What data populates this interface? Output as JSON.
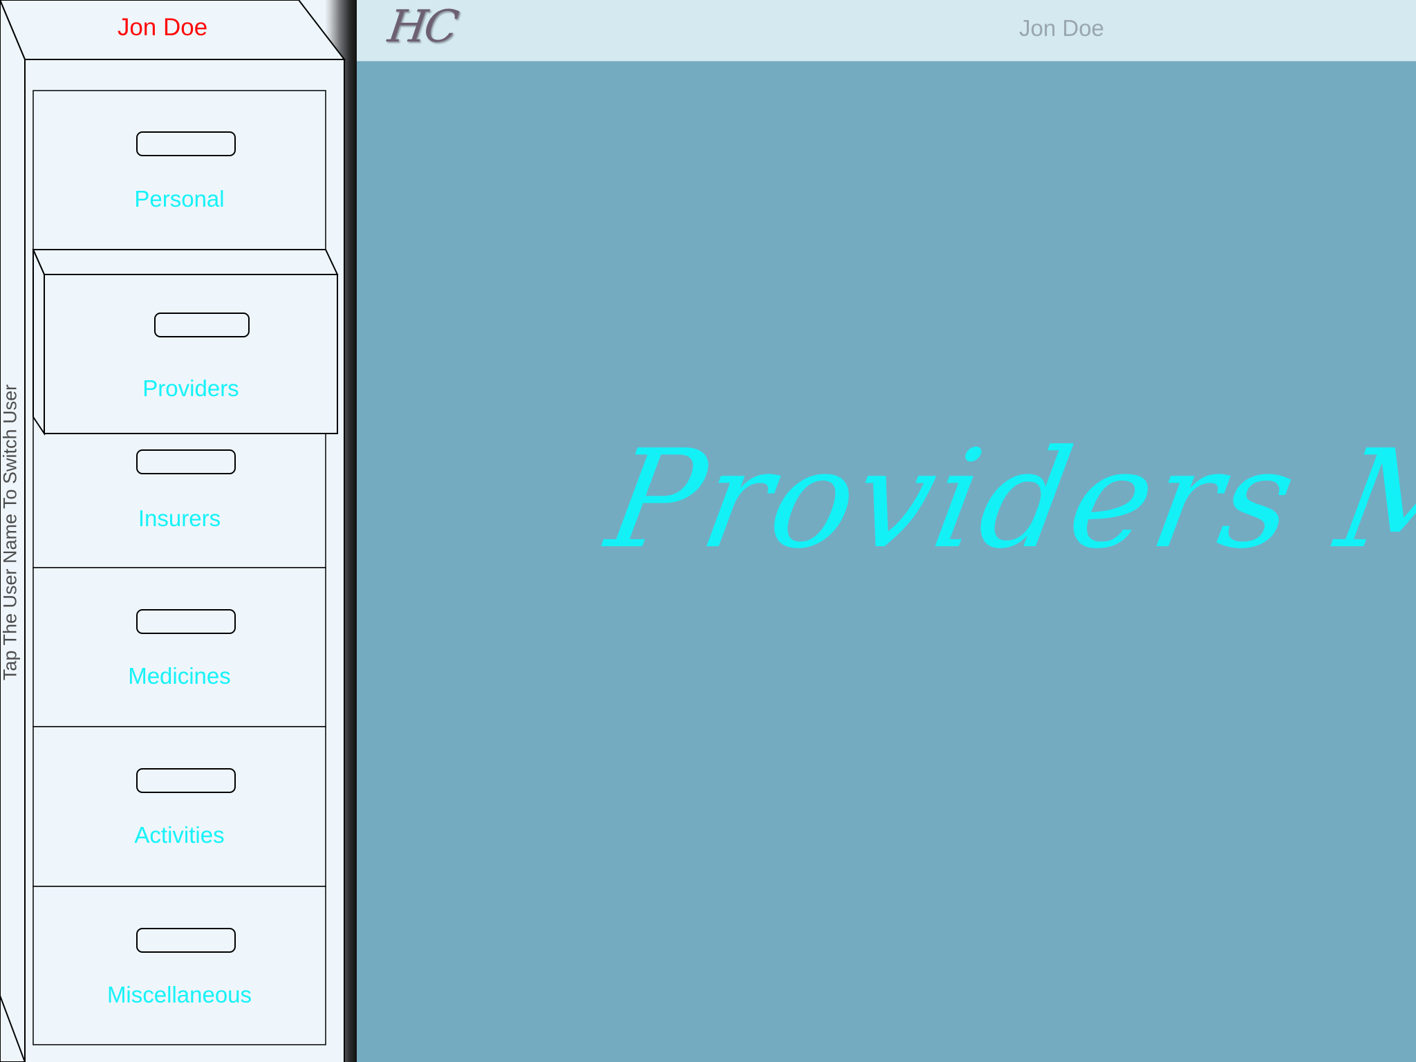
{
  "sidebar": {
    "user_name": "Jon Doe",
    "hint": "Tap The User Name To Switch User",
    "drawers": [
      {
        "label": "Personal"
      },
      {
        "label": "Providers"
      },
      {
        "label": "Insurers"
      },
      {
        "label": "Medicines"
      },
      {
        "label": "Activities"
      },
      {
        "label": "Miscellaneous"
      }
    ],
    "selected_drawer": "Providers"
  },
  "header": {
    "logo": "HC",
    "user_name": "Jon Doe"
  },
  "main": {
    "title": "Providers Manag"
  },
  "colors": {
    "user_name": "#ff0a0a",
    "drawer_label": "#16f2f8",
    "header_bg": "#d5e9f1",
    "main_bg": "#74abc1",
    "title": "#13f1f7",
    "cabinet_face": "#eef6fc"
  }
}
